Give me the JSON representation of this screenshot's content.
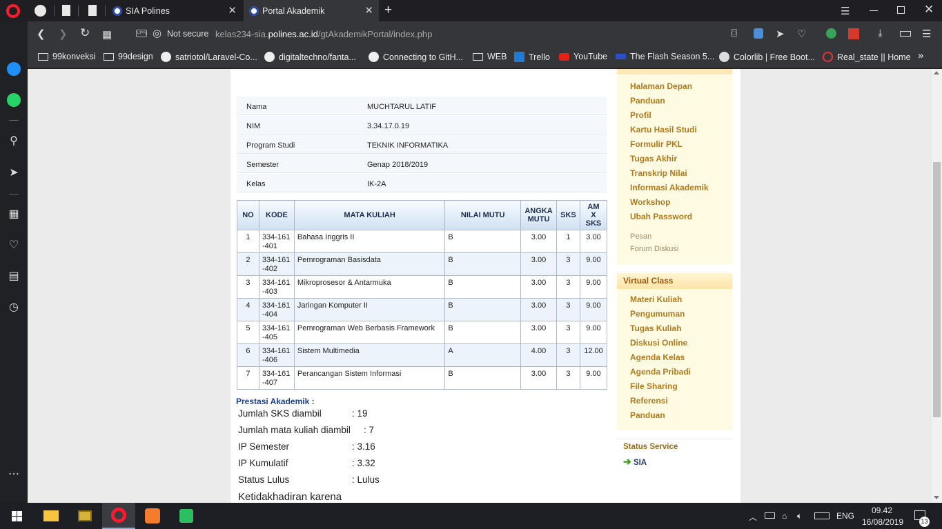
{
  "browser": {
    "tabs": [
      {
        "label": "SIA Polines"
      },
      {
        "label": "Portal Akademik"
      }
    ],
    "new_tab": "+",
    "security": "Not secure",
    "url_prefix": "kelas234-sia.",
    "url_domain": "polines.ac.id",
    "url_path": "/gtAkademikPortal/index.php",
    "bookmarks": [
      "99konveksi",
      "99design",
      "satriotol/Laravel-Co...",
      "digitaltechno/fanta...",
      "Connecting to GitH...",
      "WEB",
      "Trello",
      "YouTube",
      "The Flash Season 5...",
      "Colorlib | Free Boot...",
      "Real_state || Home"
    ],
    "bookmark_more": "»"
  },
  "student": {
    "rows": [
      {
        "label": "Nama",
        "value": "MUCHTARUL LATIF"
      },
      {
        "label": "NIM",
        "value": "3.34.17.0.19"
      },
      {
        "label": "Program Studi",
        "value": "TEKNIK INFORMATIKA"
      },
      {
        "label": "Semester",
        "value": "Genap 2018/2019"
      },
      {
        "label": "Kelas",
        "value": "IK-2A"
      }
    ]
  },
  "grades": {
    "headers": [
      "NO",
      "KODE",
      "MATA KULIAH",
      "NILAI MUTU",
      "ANGKA MUTU",
      "SKS",
      "AM X SKS"
    ],
    "rows": [
      [
        "1",
        "334-161-401",
        "Bahasa Inggris II",
        "B",
        "3.00",
        "1",
        "3.00"
      ],
      [
        "2",
        "334-161-402",
        "Pemrograman Basisdata",
        "B",
        "3.00",
        "3",
        "9.00"
      ],
      [
        "3",
        "334-161-403",
        "Mikroprosesor & Antarmuka",
        "B",
        "3.00",
        "3",
        "9.00"
      ],
      [
        "4",
        "334-161-404",
        "Jaringan Komputer II",
        "B",
        "3.00",
        "3",
        "9.00"
      ],
      [
        "5",
        "334-161-405",
        "Pemrograman Web Berbasis Framework",
        "B",
        "3.00",
        "3",
        "9.00"
      ],
      [
        "6",
        "334-161-406",
        "Sistem Multimedia",
        "A",
        "4.00",
        "3",
        "12.00"
      ],
      [
        "7",
        "334-161-407",
        "Perancangan Sistem Informasi",
        "B",
        "3.00",
        "3",
        "9.00"
      ]
    ]
  },
  "prestasi": {
    "title": "Prestasi Akademik :",
    "items": [
      {
        "label": "Jumlah SKS diambil",
        "value": ": 19"
      },
      {
        "label": "Jumlah mata kuliah diambil",
        "value": ": 7"
      },
      {
        "label": "IP Semester",
        "value": ": 3.16"
      },
      {
        "label": "IP Kumulatif",
        "value": ": 3.32"
      },
      {
        "label": "Status Lulus",
        "value": ": Lulus"
      }
    ],
    "absence": "Ketidakhadiran karena"
  },
  "menu": {
    "main": [
      "Halaman Depan",
      "Panduan",
      "Profil",
      "Kartu Hasil Studi",
      "Formulir PKL",
      "Tugas Akhir",
      "Transkrip Nilai",
      "Informasi Akademik",
      "Workshop",
      "Ubah Password"
    ],
    "secondary": [
      "Pesan",
      "Forum Diskusi"
    ],
    "virtual_class_title": "Virtual Class",
    "virtual_class": [
      "Materi Kuliah",
      "Pengumuman",
      "Tugas Kuliah",
      "Diskusi Online",
      "Agenda Kelas",
      "Agenda Pribadi",
      "File Sharing",
      "Referensi",
      "Panduan"
    ],
    "status_title": "Status Service",
    "status_item": "SIA"
  },
  "taskbar": {
    "lang": "ENG",
    "time": "09.42",
    "date": "16/08/2019",
    "notifications": "13"
  },
  "colors": {
    "accent_menu": "#b07a1c",
    "prestasi_title": "#1c3f91",
    "opera_red": "#ff1b2d"
  }
}
